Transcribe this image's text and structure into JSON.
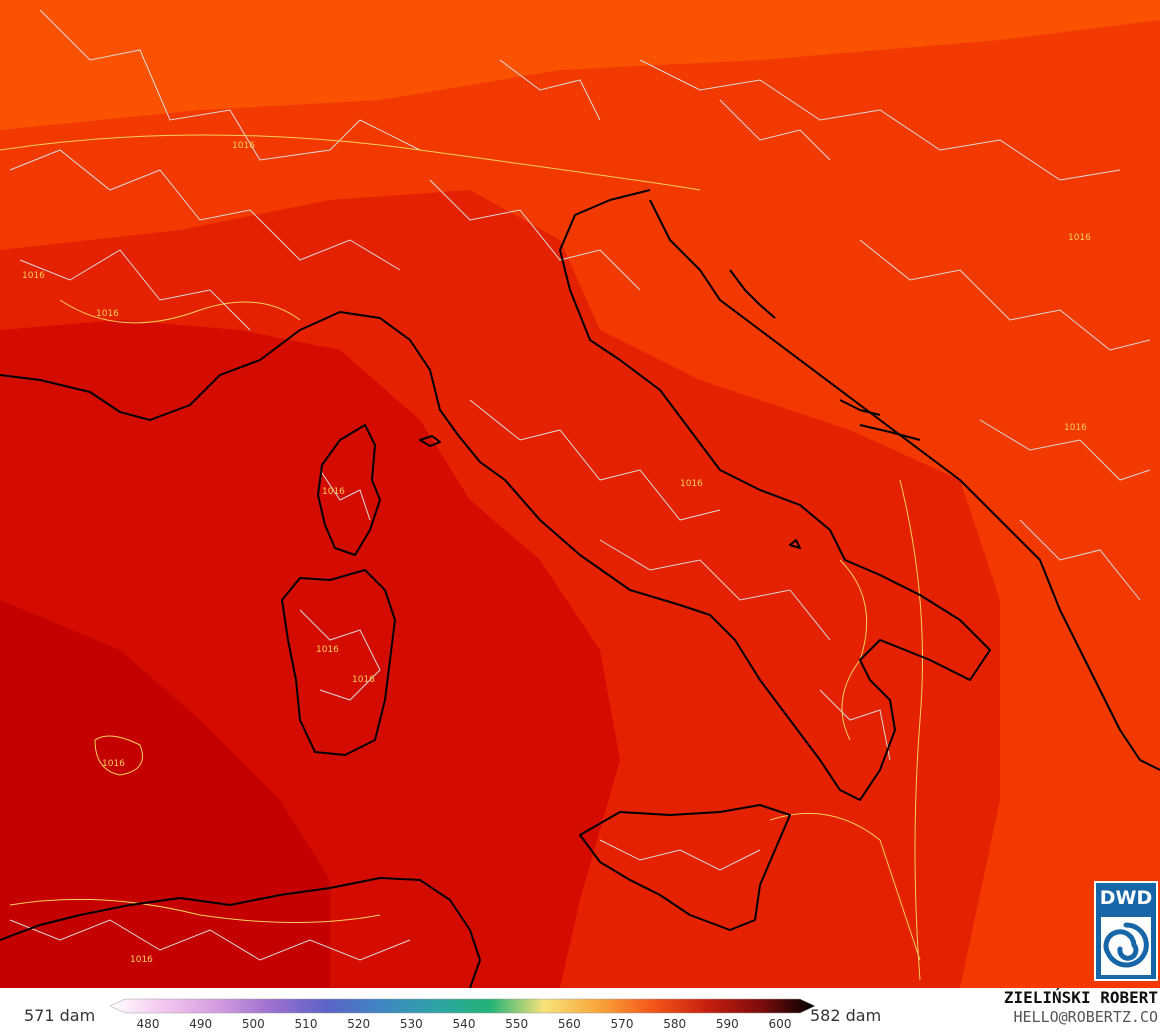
{
  "map": {
    "isobar_label": "1016",
    "colors": {
      "sea_deep": "#c40000",
      "band_580": "#d40c00",
      "band_578": "#e42100",
      "band_576": "#f23a00",
      "band_574": "#fa5200",
      "coast": "#000000",
      "borders": "#d9d9d9",
      "isobar": "#f2d15c"
    }
  },
  "legend": {
    "min_label": "571 dam",
    "max_label": "582 dam",
    "ticks": [
      "480",
      "490",
      "500",
      "510",
      "520",
      "530",
      "540",
      "550",
      "560",
      "570",
      "580",
      "590",
      "600"
    ],
    "gradient_colors": [
      "#ffffff",
      "#f3c6ef",
      "#d49be0",
      "#9a6fcf",
      "#5c63c6",
      "#3f86c3",
      "#2ea3a6",
      "#22b276",
      "#f7e27a",
      "#f9a63b",
      "#f4571a",
      "#c71f0e",
      "#7d0c0c",
      "#000000"
    ]
  },
  "logo": {
    "text": "DWD",
    "bg_color": "#1767a8"
  },
  "credits": {
    "name": "ZIELIŃSKI ROBERT",
    "email": "HELLO@ROBERTZ.CO"
  }
}
